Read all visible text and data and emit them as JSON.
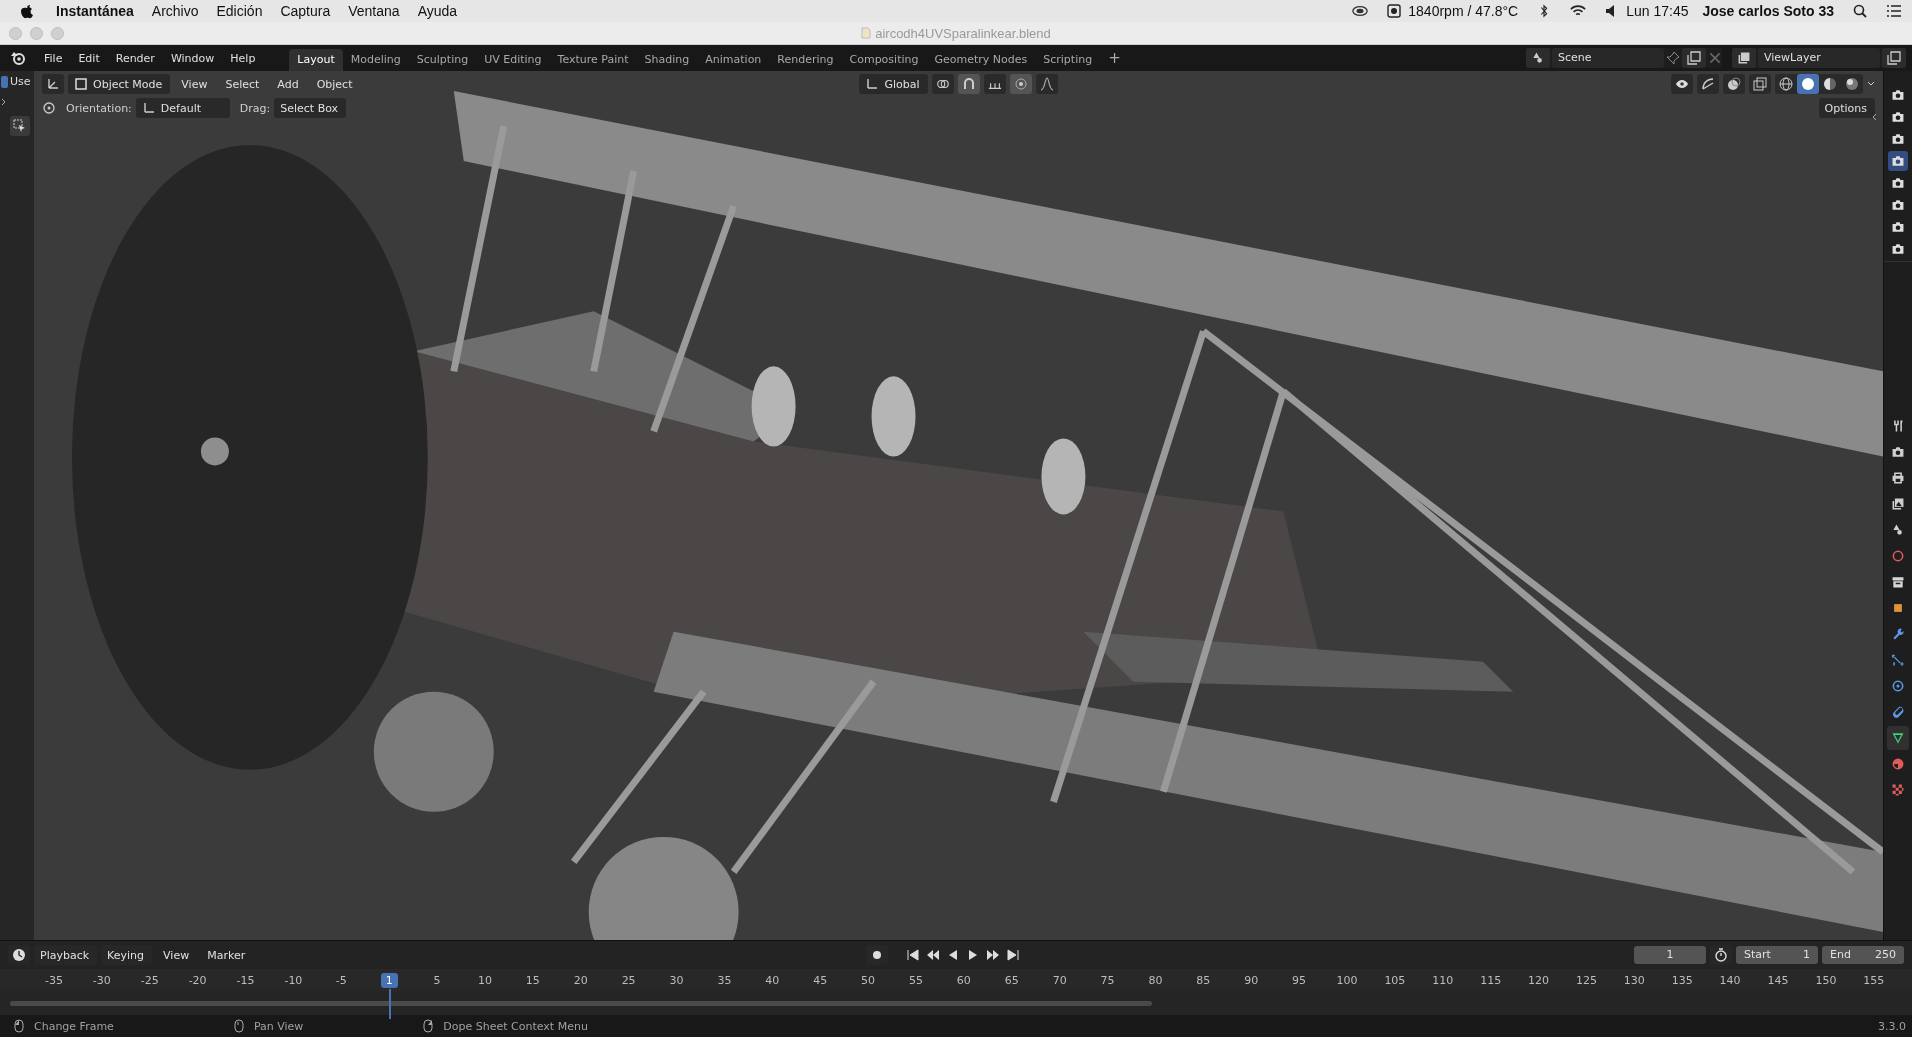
{
  "mac_menu_bar": {
    "app_name": "Instantánea",
    "menus": [
      "Archivo",
      "Edición",
      "Captura",
      "Ventana",
      "Ayuda"
    ],
    "sensor": "1840rpm / 47.8°C",
    "clock": "Lun 17:45",
    "user": "Jose carlos Soto 33"
  },
  "window": {
    "title": "aircodh4UVSparalinkear.blend"
  },
  "topbar": {
    "menus": [
      "File",
      "Edit",
      "Render",
      "Window",
      "Help"
    ],
    "workspaces": [
      {
        "label": "Layout",
        "selected": true
      },
      {
        "label": "Modeling",
        "selected": false
      },
      {
        "label": "Sculpting",
        "selected": false
      },
      {
        "label": "UV Editing",
        "selected": false
      },
      {
        "label": "Texture Paint",
        "selected": false
      },
      {
        "label": "Shading",
        "selected": false
      },
      {
        "label": "Animation",
        "selected": false
      },
      {
        "label": "Rendering",
        "selected": false
      },
      {
        "label": "Compositing",
        "selected": false
      },
      {
        "label": "Geometry Nodes",
        "selected": false
      },
      {
        "label": "Scripting",
        "selected": false
      }
    ],
    "add_workspace": "+",
    "scene": "Scene",
    "view_layer": "ViewLayer"
  },
  "toolbar": {
    "use_option": {
      "label": "Use",
      "checked": true
    }
  },
  "viewport_header": {
    "mode": "Object Mode",
    "menus": [
      "View",
      "Select",
      "Add",
      "Object"
    ],
    "transform": "Global",
    "shading": [
      {
        "kind": "wireframe",
        "selected": false
      },
      {
        "kind": "solid",
        "selected": true
      },
      {
        "kind": "material",
        "selected": false
      },
      {
        "kind": "rendered",
        "selected": false
      }
    ]
  },
  "tool_header": {
    "orientation_label": "Orientation:",
    "orientation": "Default",
    "drag_label": "Drag:",
    "drag": "Select Box",
    "options": "Options"
  },
  "collections": [
    {
      "selected": false
    },
    {
      "selected": false
    },
    {
      "selected": false
    },
    {
      "selected": true
    },
    {
      "selected": false
    },
    {
      "selected": false
    },
    {
      "selected": false
    },
    {
      "selected": false
    }
  ],
  "properties_tabs": [
    {
      "kind": "tool",
      "selected": false
    },
    {
      "kind": "render",
      "selected": false
    },
    {
      "kind": "output",
      "selected": false
    },
    {
      "kind": "view_layer",
      "selected": false
    },
    {
      "kind": "scene",
      "selected": false
    },
    {
      "kind": "world",
      "selected": false
    },
    {
      "kind": "collection",
      "selected": false
    },
    {
      "kind": "object",
      "selected": false
    },
    {
      "kind": "modifiers",
      "selected": false
    },
    {
      "kind": "particles",
      "selected": false
    },
    {
      "kind": "physics",
      "selected": false
    },
    {
      "kind": "constraints",
      "selected": false
    },
    {
      "kind": "data",
      "selected": true
    },
    {
      "kind": "material",
      "selected": false
    },
    {
      "kind": "texture",
      "selected": false
    }
  ],
  "timeline": {
    "menus": [
      "Playback",
      "Keying",
      "View",
      "Marker"
    ],
    "current_frame": "1",
    "start_label": "Start",
    "start": "1",
    "end_label": "End",
    "end": "250",
    "ticks": [
      {
        "label": "-35",
        "selected": false
      },
      {
        "label": "-30",
        "selected": false
      },
      {
        "label": "-25",
        "selected": false
      },
      {
        "label": "-20",
        "selected": false
      },
      {
        "label": "-15",
        "selected": false
      },
      {
        "label": "-10",
        "selected": false
      },
      {
        "label": "-5",
        "selected": false
      },
      {
        "label": "1",
        "selected": true
      },
      {
        "label": "5",
        "selected": false
      },
      {
        "label": "10",
        "selected": false
      },
      {
        "label": "15",
        "selected": false
      },
      {
        "label": "20",
        "selected": false
      },
      {
        "label": "25",
        "selected": false
      },
      {
        "label": "30",
        "selected": false
      },
      {
        "label": "35",
        "selected": false
      },
      {
        "label": "40",
        "selected": false
      },
      {
        "label": "45",
        "selected": false
      },
      {
        "label": "50",
        "selected": false
      },
      {
        "label": "55",
        "selected": false
      },
      {
        "label": "60",
        "selected": false
      },
      {
        "label": "65",
        "selected": false
      },
      {
        "label": "70",
        "selected": false
      },
      {
        "label": "75",
        "selected": false
      },
      {
        "label": "80",
        "selected": false
      },
      {
        "label": "85",
        "selected": false
      },
      {
        "label": "90",
        "selected": false
      },
      {
        "label": "95",
        "selected": false
      },
      {
        "label": "100",
        "selected": false
      },
      {
        "label": "105",
        "selected": false
      },
      {
        "label": "110",
        "selected": false
      },
      {
        "label": "115",
        "selected": false
      },
      {
        "label": "120",
        "selected": false
      },
      {
        "label": "125",
        "selected": false
      },
      {
        "label": "130",
        "selected": false
      },
      {
        "label": "135",
        "selected": false
      },
      {
        "label": "140",
        "selected": false
      },
      {
        "label": "145",
        "selected": false
      },
      {
        "label": "150",
        "selected": false
      },
      {
        "label": "155",
        "selected": false
      }
    ]
  },
  "status_bar": {
    "hints": [
      "Change Frame",
      "Pan View",
      "Dope Sheet Context Menu"
    ],
    "version": "3.3.0"
  }
}
